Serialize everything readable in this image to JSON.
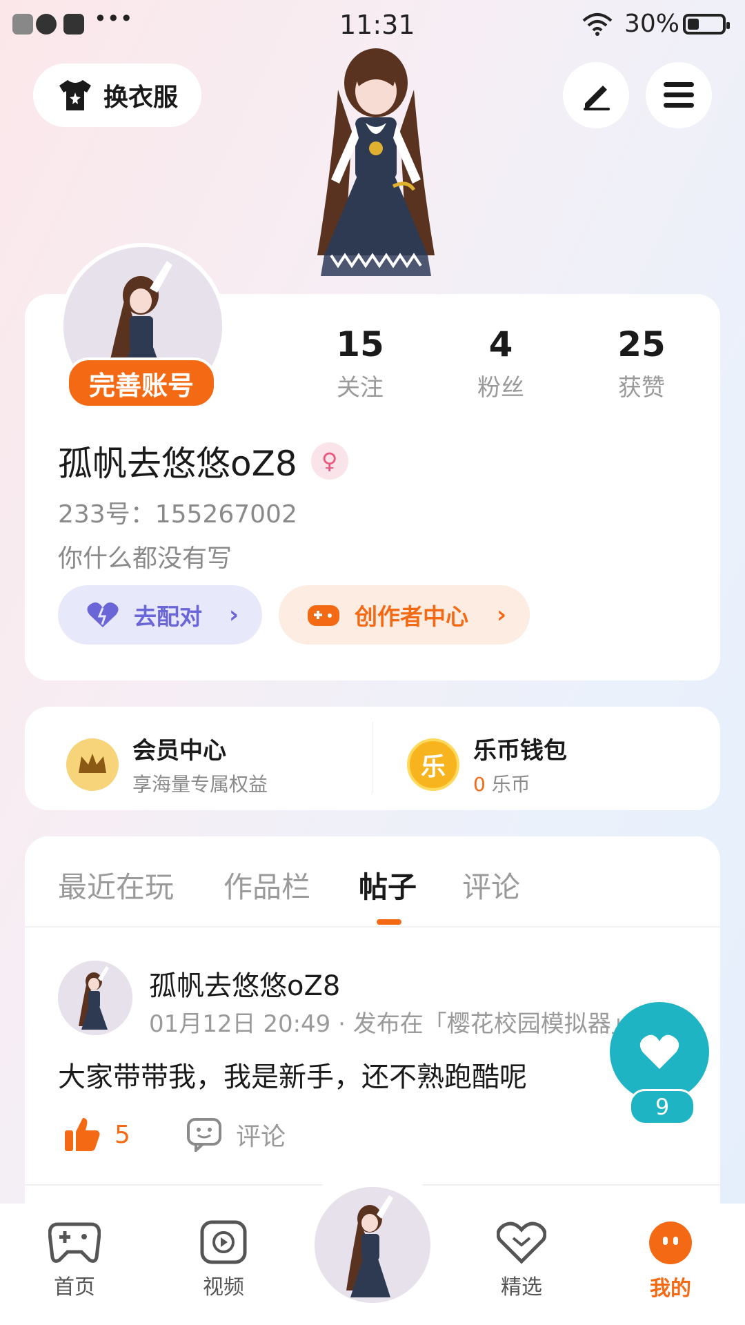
{
  "status_bar": {
    "time": "11:31",
    "battery": "30%"
  },
  "top_bar": {
    "outfit_label": "换衣服"
  },
  "profile": {
    "complete_label": "完善账号",
    "stats": [
      {
        "value": "15",
        "label": "关注"
      },
      {
        "value": "4",
        "label": "粉丝"
      },
      {
        "value": "25",
        "label": "获赞"
      }
    ],
    "username": "孤帆去悠悠oZ8",
    "uid": "233号：155267002",
    "bio": "你什么都没有写",
    "match_label": "去配对",
    "creator_label": "创作者中心"
  },
  "member": {
    "title": "会员中心",
    "subtitle": "享海量专属权益"
  },
  "wallet": {
    "title": "乐币钱包",
    "amount": "0",
    "unit": "乐币",
    "coin_glyph": "乐"
  },
  "tabs": [
    {
      "label": "最近在玩"
    },
    {
      "label": "作品栏"
    },
    {
      "label": "帖子"
    },
    {
      "label": "评论"
    }
  ],
  "post": {
    "user": "孤帆去悠悠oZ8",
    "meta": "01月12日 20:49 · 发布在「樱花校园模拟器」",
    "text": "大家带带我，我是新手，还不熟跑酷呢",
    "likes": "5",
    "comment_label": "评论"
  },
  "floating_like": {
    "count": "9"
  },
  "nav": [
    {
      "label": "首页"
    },
    {
      "label": "视频"
    },
    {
      "label": "精选"
    },
    {
      "label": "我的"
    }
  ],
  "colors": {
    "accent": "#f46a14",
    "teal": "#1eb4c4",
    "purple": "#6b66d8"
  }
}
